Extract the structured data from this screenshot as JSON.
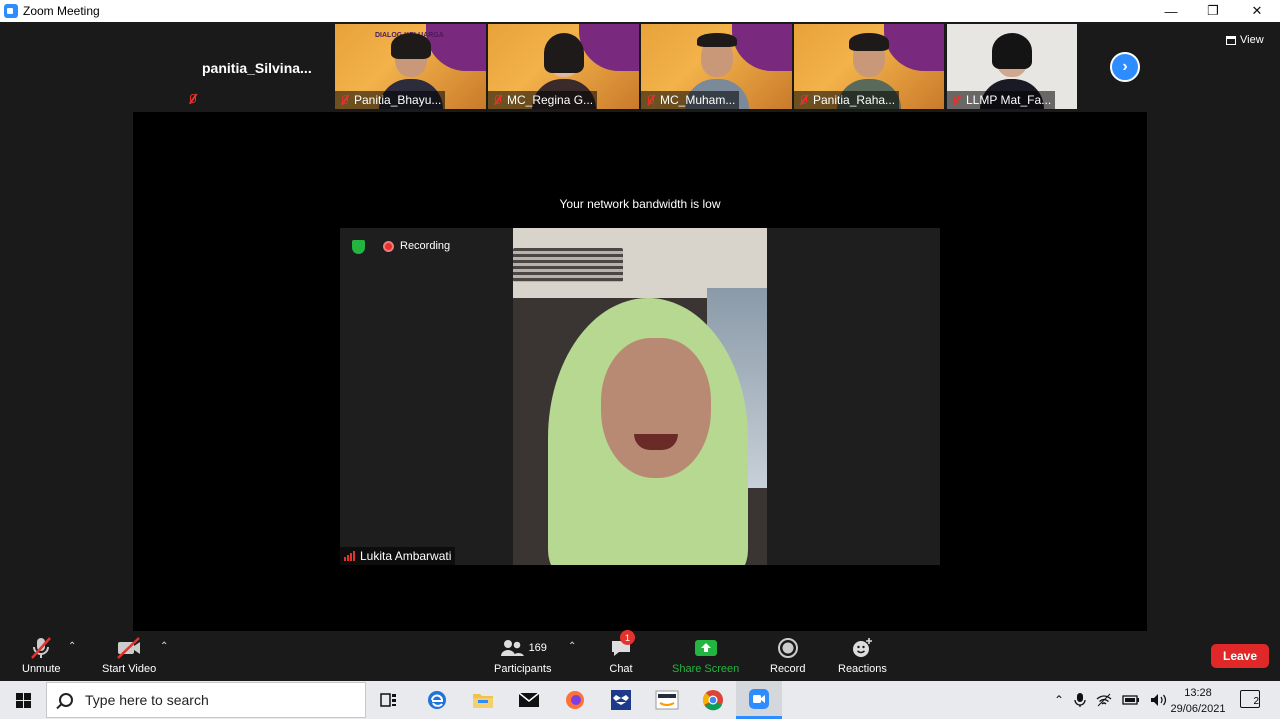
{
  "window": {
    "title": "Zoom Meeting"
  },
  "gallery_strip": {
    "name_tile": {
      "name": "panitia_Silvina..."
    },
    "tiles": [
      {
        "label": "Panitia_Bhayu..."
      },
      {
        "label": "MC_Regina G..."
      },
      {
        "label": "MC_Muham..."
      },
      {
        "label": "Panitia_Raha..."
      },
      {
        "label": "LLMP Mat_Fa..."
      }
    ],
    "banner_text": "DIALOG KELUARGA"
  },
  "view_button": {
    "label": "View"
  },
  "main": {
    "bandwidth_notice": "Your network bandwidth is low",
    "recording_label": "Recording",
    "speaker_name": "Lukita Ambarwati"
  },
  "toolbar": {
    "unmute": "Unmute",
    "start_video": "Start Video",
    "participants_count": "169",
    "participants": "Participants",
    "chat": "Chat",
    "chat_badge": "1",
    "share_screen": "Share Screen",
    "record": "Record",
    "reactions": "Reactions",
    "leave": "Leave"
  },
  "taskbar": {
    "search_placeholder": "Type here to search",
    "time": "13:28",
    "date": "29/06/2021",
    "notification_count": "2"
  },
  "colors": {
    "accent": "#2d8cff",
    "leave": "#e02828",
    "share": "#23b53f",
    "muted": "#e5322d"
  }
}
